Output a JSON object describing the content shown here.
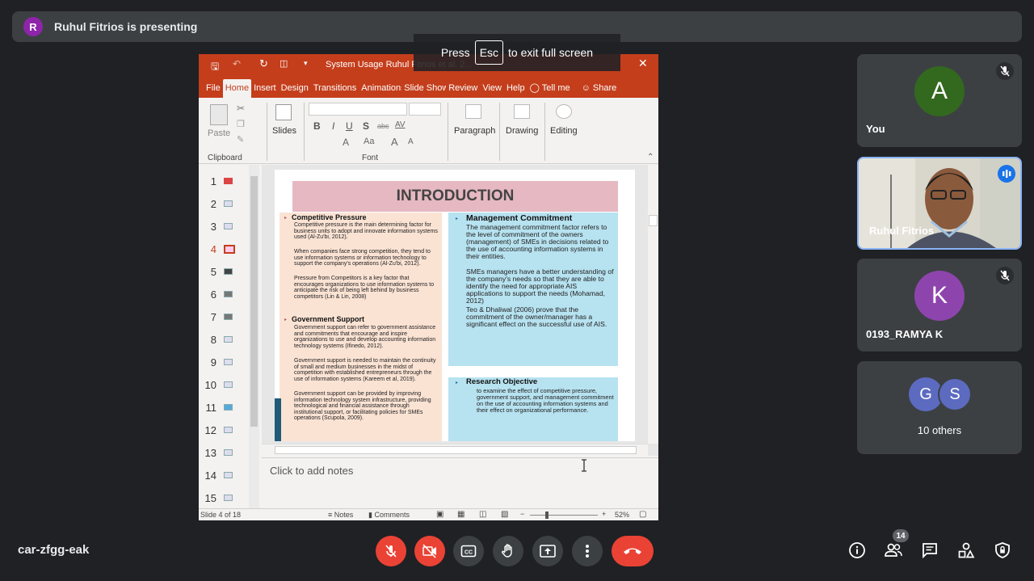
{
  "presenting": {
    "avatar_letter": "R",
    "text": "Ruhul Fitrios is presenting"
  },
  "fullscreen_hint": {
    "press": "Press",
    "key": "Esc",
    "suffix": "to exit full screen"
  },
  "ppt": {
    "title": "System Usage Ruhul Fitrios et al. 2...",
    "tabs": [
      "File",
      "Home",
      "Insert",
      "Design",
      "Transitions",
      "Animations",
      "Slide Show",
      "Review",
      "View",
      "Help",
      "Tell me",
      "Share"
    ],
    "active_tab": "Home",
    "ribbon": {
      "paste": "Paste",
      "clipboard": "Clipboard",
      "slides": "Slides",
      "font": "Font",
      "paragraph": "Paragraph",
      "drawing": "Drawing",
      "editing": "Editing",
      "bold": "B",
      "italic": "I",
      "underline": "U",
      "strike": "S",
      "abc": "abc",
      "av": "AV",
      "aa": "Aa",
      "a_big": "A",
      "a_small": "A"
    },
    "slide_numbers": [
      "1",
      "2",
      "3",
      "4",
      "5",
      "6",
      "7",
      "8",
      "9",
      "10",
      "11",
      "12",
      "13",
      "14",
      "15"
    ],
    "active_slide": "4",
    "slide": {
      "title": "INTRODUCTION",
      "left": {
        "heading1": "Competitive Pressure",
        "bullets1": [
          "Competitive pressure is the main determining factor for business units to adopt and innovate information systems used (Al-Zu'bi, 2012).",
          "When companies face strong competition, they tend to use information systems or information technology to support the company's operations (Al-Zu'bi, 2012).",
          "Pressure from Competitors is a key factor that encourages organizations to use information systems to anticipate the risk of being left behind by business competitors (Lin & Lin, 2008)"
        ],
        "heading2": "Government Support",
        "bullets2": [
          "Government support can refer to government assistance and commitments that encourage and inspire organizations to use and develop accounting information technology systems (Ifinedo, 2012).",
          "Government support is needed to maintain the continuity of small and medium businesses in the midst of competition with established entrepreneurs through the use of information systems (Kareem et al, 2019).",
          "Government support can be provided by improving information technology system infrastructure, providing technological and financial assistance through institutional support, or facilitating policies for SMEs operations (Scupola, 2009)."
        ]
      },
      "right": {
        "heading1": "Management Commitment",
        "bullets1": [
          "The management commitment factor refers to the level of commitment of the owners (management) of SMEs in decisions related to the use of accounting information systems in their entities.",
          "SMEs managers have a better understanding of the company's needs so that they are able to identify the need for appropriate AIS applications to support the needs (Mohamad, 2012)",
          "Teo & Dhaliwal (2006) prove that the commitment of the owner/manager has a significant effect on the successful use of AIS."
        ],
        "heading2": "Research Objective",
        "bullets2": [
          "to examine the effect of competitive pressure, government support, and management commitment on the use of accounting information systems and their effect on organizational performance."
        ]
      }
    },
    "notes_placeholder": "Click to add notes",
    "status": {
      "slide_of": "Slide 4 of 18",
      "notes": "Notes",
      "comments": "Comments",
      "zoom": "52%"
    }
  },
  "participants": [
    {
      "name": "You",
      "avatar_letter": "A",
      "avatar_color": "#33691e",
      "muted": true
    },
    {
      "name": "Ruhul Fitrios",
      "video": true,
      "speaking": true
    },
    {
      "name": "0193_RAMYA K",
      "avatar_letter": "K",
      "avatar_color": "#8e44ad",
      "muted": true
    },
    {
      "name": "10 others",
      "letters": [
        "G",
        "S"
      ],
      "color": "#5c6bc0"
    }
  ],
  "bottom": {
    "meeting_code": "car-zfgg-eak",
    "people_count": "14"
  }
}
